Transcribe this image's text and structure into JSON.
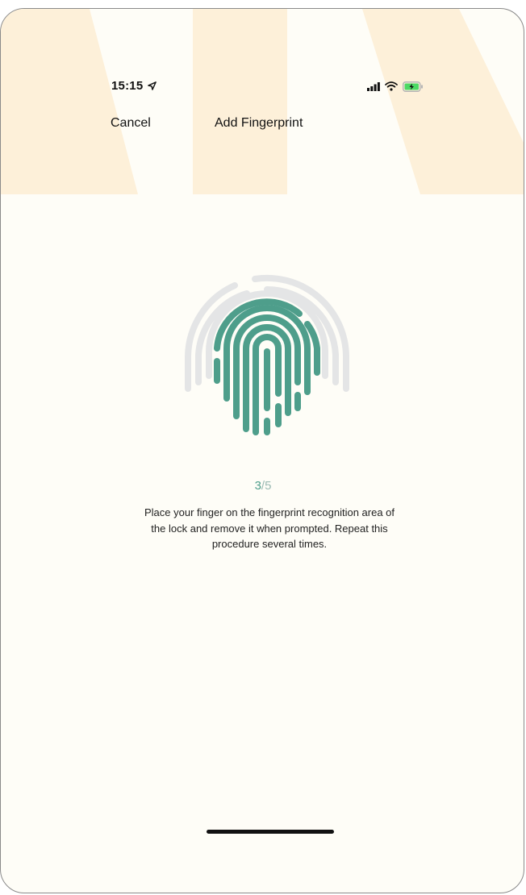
{
  "status_bar": {
    "time": "15:15",
    "icons": [
      "location-arrow-icon",
      "cellular-signal-icon",
      "wifi-icon",
      "battery-charging-icon"
    ]
  },
  "nav": {
    "cancel_label": "Cancel",
    "title": "Add Fingerprint"
  },
  "enrollment": {
    "current_step": "3",
    "separator": "/",
    "total_steps": "5",
    "instructions": "Place your finger on the fingerprint recognition area of the lock and remove it when prompted. Repeat this procedure several times."
  },
  "colors": {
    "accent_green": "#4e9e8b",
    "header_stripe": "#fdf0d9",
    "background": "#fefdf7",
    "fingerprint_gray": "#e4e5e6"
  }
}
